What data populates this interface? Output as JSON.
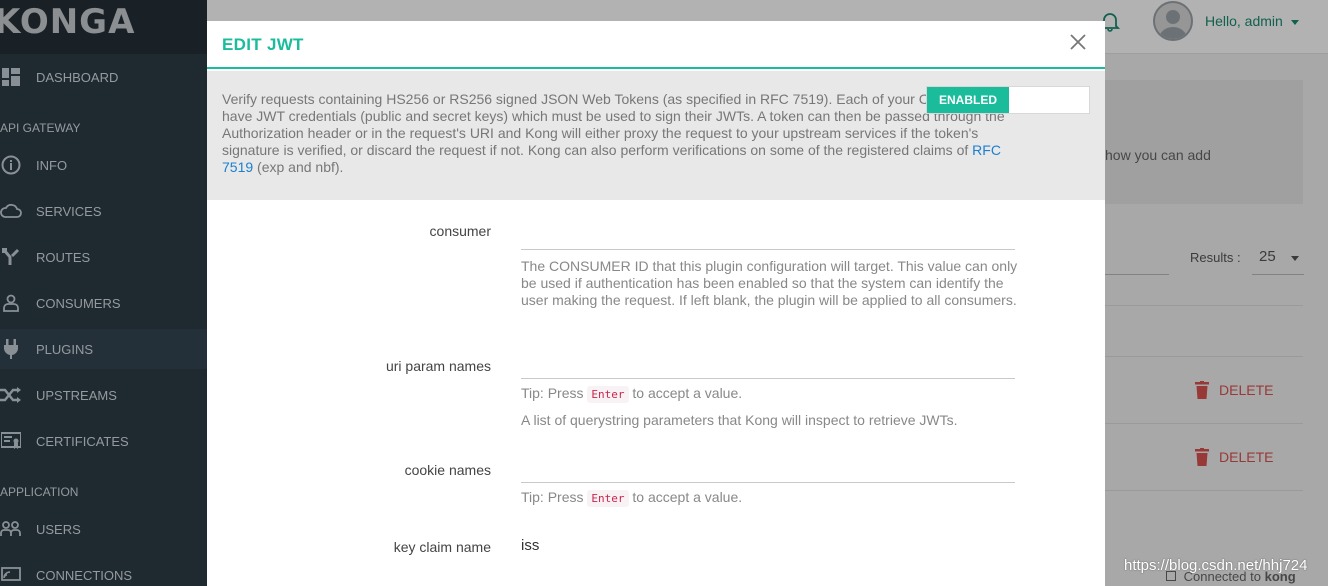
{
  "sidebar": {
    "brand": "KONGA",
    "items": [
      {
        "label": "DASHBOARD",
        "icon": "dashboard-icon"
      },
      {
        "label": "INFO",
        "icon": "info-icon"
      },
      {
        "label": "SERVICES",
        "icon": "cloud-icon"
      },
      {
        "label": "ROUTES",
        "icon": "routes-icon"
      },
      {
        "label": "CONSUMERS",
        "icon": "user-icon"
      },
      {
        "label": "PLUGINS",
        "icon": "plug-icon"
      },
      {
        "label": "UPSTREAMS",
        "icon": "shuffle-icon"
      },
      {
        "label": "CERTIFICATES",
        "icon": "certificate-icon"
      },
      {
        "label": "USERS",
        "icon": "users-icon"
      },
      {
        "label": "CONNECTIONS",
        "icon": "connections-icon"
      }
    ],
    "sections": {
      "api_gateway": "API GATEWAY",
      "application": "APPLICATION"
    }
  },
  "topbar": {
    "greeting": "Hello, admin"
  },
  "background": {
    "panel_text": "how you can add",
    "results_label": "Results :",
    "results_value": "25",
    "delete_label": "DELETE",
    "status_prefix": "Connected to",
    "status_name": "kong",
    "watermark": "https://blog.csdn.net/hhj724"
  },
  "modal": {
    "title": "EDIT JWT",
    "toggle_label": "ENABLED",
    "description_text": "Verify requests containing HS256 or RS256 signed JSON Web Tokens (as specified in RFC 7519). Each of your Consumers will have JWT credentials (public and secret keys) which must be used to sign their JWTs. A token can then be passed through the Authorization header or in the request's URI and Kong will either proxy the request to your upstream services if the token's signature is verified, or discard the request if not. Kong can also perform verifications on some of the registered claims of",
    "description_link": "RFC 7519",
    "description_suffix": "(exp and nbf).",
    "fields": {
      "consumer": {
        "label": "consumer",
        "value": "",
        "help": "The CONSUMER ID that this plugin configuration will target. This value can only be used if authentication has been enabled so that the system can identify the user making the request. If left blank, the plugin will be applied to all consumers."
      },
      "uri_param_names": {
        "label": "uri param names",
        "value": "",
        "tip_prefix": "Tip: Press",
        "tip_key": "Enter",
        "tip_suffix": "to accept a value.",
        "help": "A list of querystring parameters that Kong will inspect to retrieve JWTs."
      },
      "cookie_names": {
        "label": "cookie names",
        "value": "",
        "tip_prefix": "Tip: Press",
        "tip_key": "Enter",
        "tip_suffix": "to accept a value."
      },
      "key_claim_name": {
        "label": "key claim name",
        "value": "iss"
      }
    }
  },
  "colors": {
    "accent": "#1abc9c",
    "sidebar_bg": "#2b3b46",
    "delete": "#d9534f",
    "link": "#1c7fd0"
  }
}
